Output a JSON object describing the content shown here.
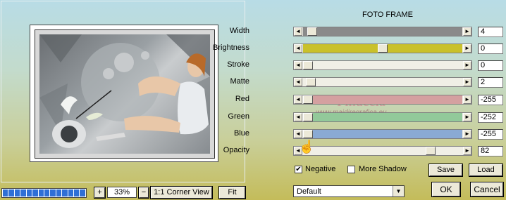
{
  "dialog": {
    "title": "FOTO FRAME"
  },
  "watermark": {
    "line1": "Pinuccia",
    "line2": "www.maidiregrafica.eu"
  },
  "sliders": [
    {
      "id": "width",
      "label": "Width",
      "value": "4",
      "fill": 0.03,
      "color": "#8a8a8a"
    },
    {
      "id": "brightness",
      "label": "Brightness",
      "value": "0",
      "fill": 0.5,
      "color": "#c9c12a"
    },
    {
      "id": "stroke",
      "label": "Stroke",
      "value": "0",
      "fill": 0.0,
      "color": "#f0efe6"
    },
    {
      "id": "matte",
      "label": "Matte",
      "value": "2",
      "fill": 0.02,
      "color": "#f0efe6"
    },
    {
      "id": "red",
      "label": "Red",
      "value": "-255",
      "fill": 0.0,
      "color": "#d4a0a0"
    },
    {
      "id": "green",
      "label": "Green",
      "value": "-252",
      "fill": 0.0,
      "color": "#92c99a"
    },
    {
      "id": "blue",
      "label": "Blue",
      "value": "-255",
      "fill": 0.0,
      "color": "#8aaad4"
    },
    {
      "id": "opacity",
      "label": "Opacity",
      "value": "82",
      "fill": 0.82,
      "color": "#f0efe6"
    }
  ],
  "options": {
    "negative_label": "Negative",
    "negative_checked": true,
    "more_shadow_label": "More Shadow",
    "more_shadow_checked": false
  },
  "buttons": {
    "save": "Save",
    "load": "Load",
    "ok": "OK",
    "cancel": "Cancel"
  },
  "preset": {
    "selected": "Default"
  },
  "zoom": {
    "plus": "+",
    "value": "33%",
    "minus": "−",
    "one_to_one": "1:1 Corner View",
    "fit": "Fit"
  },
  "progress": {
    "segments": 14,
    "filled": 14
  },
  "colors": {
    "accent": "#2f6fd6"
  }
}
